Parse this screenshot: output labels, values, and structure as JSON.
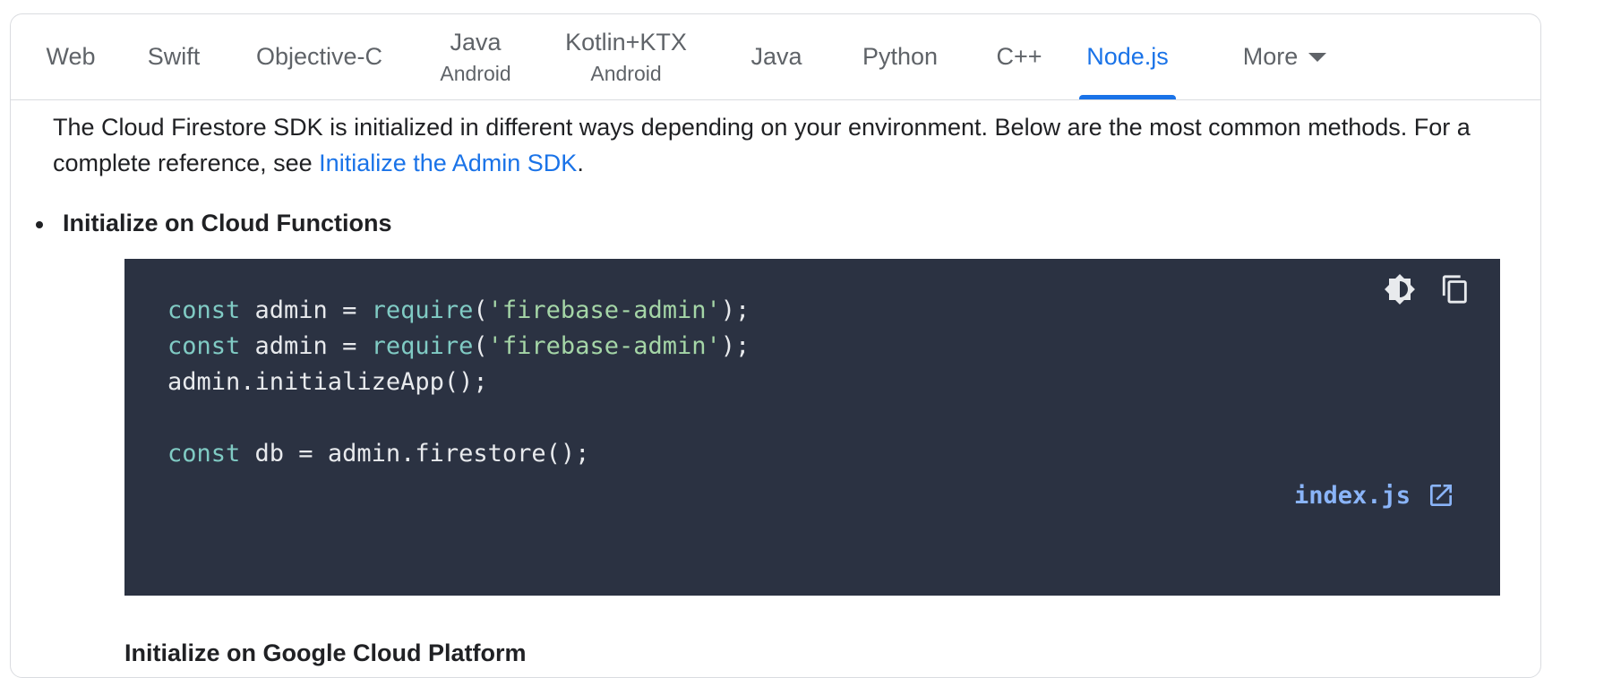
{
  "tabs": [
    {
      "label": "Web",
      "sub": ""
    },
    {
      "label": "Swift",
      "sub": ""
    },
    {
      "label": "Objective-C",
      "sub": ""
    },
    {
      "label": "Java",
      "sub": "Android"
    },
    {
      "label": "Kotlin+KTX",
      "sub": "Android"
    },
    {
      "label": "Java",
      "sub": ""
    },
    {
      "label": "Python",
      "sub": ""
    },
    {
      "label": "C++",
      "sub": ""
    },
    {
      "label": "Node.js",
      "sub": "",
      "active": true
    },
    {
      "label": "More",
      "sub": ""
    }
  ],
  "intro": {
    "text": "The Cloud Firestore SDK is initialized in different ways depending on your environment. Below are the most common methods. For a complete reference, see ",
    "link": "Initialize the Admin SDK",
    "after": "."
  },
  "section": {
    "bullet": "Initialize on Cloud Functions"
  },
  "code": {
    "lines": [
      [
        {
          "t": "const",
          "c": "kw"
        },
        {
          "t": " admin = ",
          "c": ""
        },
        {
          "t": "require",
          "c": "fn"
        },
        {
          "t": "(",
          "c": ""
        },
        {
          "t": "'firebase-admin'",
          "c": "str"
        },
        {
          "t": ");",
          "c": ""
        }
      ],
      [
        {
          "t": "const",
          "c": "kw"
        },
        {
          "t": " admin = ",
          "c": ""
        },
        {
          "t": "require",
          "c": "fn"
        },
        {
          "t": "(",
          "c": ""
        },
        {
          "t": "'firebase-admin'",
          "c": "str"
        },
        {
          "t": ");",
          "c": ""
        }
      ],
      [
        {
          "t": "admin.initializeApp();",
          "c": ""
        }
      ],
      [],
      [
        {
          "t": "const",
          "c": "kw"
        },
        {
          "t": " db = admin.firestore();",
          "c": ""
        }
      ]
    ],
    "file_link": "index.js",
    "theme_icon": "theme-toggle-icon",
    "copy_icon": "copy-icon",
    "link_icon": "open-in-new-icon"
  },
  "next_heading": "Initialize on Google Cloud Platform",
  "colors": {
    "accent": "#1a73e8",
    "code_bg": "#2b3242",
    "keyword": "#80cbc4",
    "string": "#a5d6a7",
    "file_link": "#8ab4f8"
  }
}
